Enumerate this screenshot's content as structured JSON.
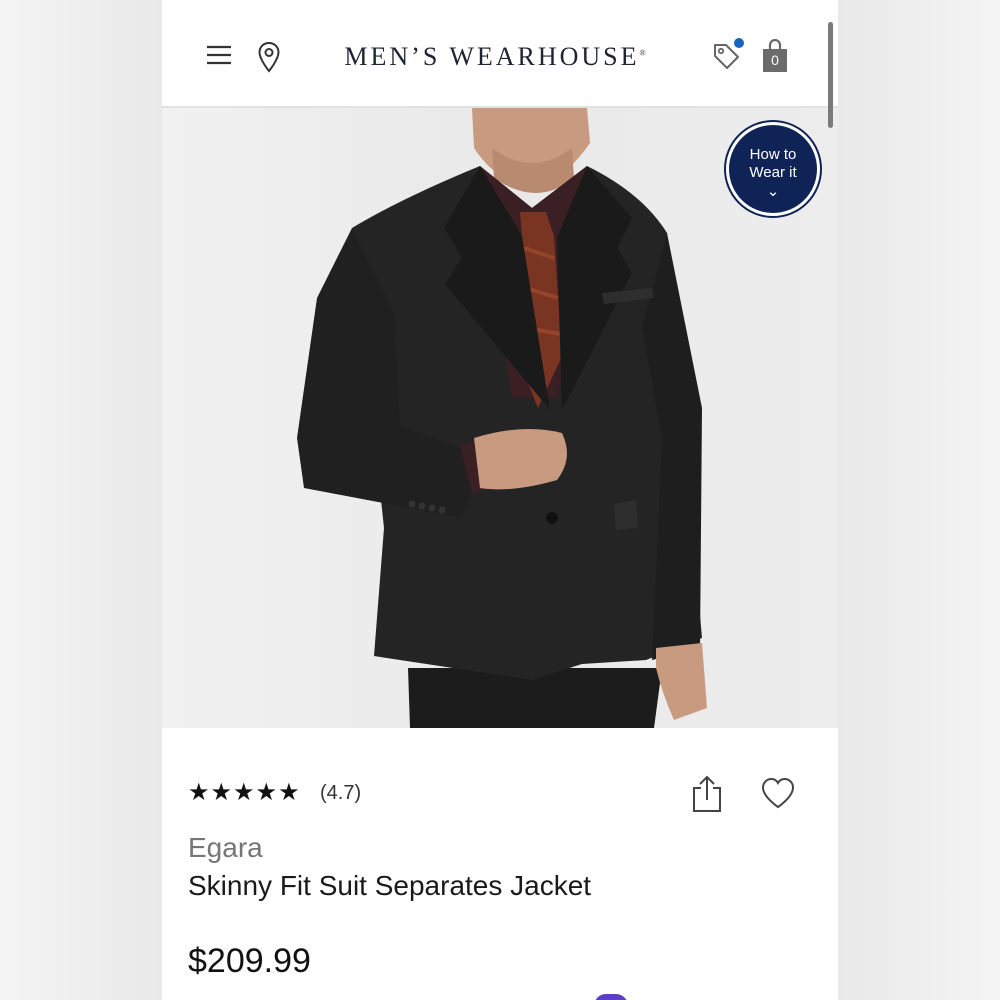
{
  "header": {
    "brand": "MEN’S WEARHOUSE",
    "brand_mark": "®",
    "cart_count": "0",
    "icons": [
      "menu-icon",
      "location-pin-icon",
      "tag-icon",
      "shopping-bag-icon"
    ],
    "notification_color": "#1565c0"
  },
  "hero": {
    "badge_line1": "How to",
    "badge_line2": "Wear it",
    "badge_chevron": "⌄",
    "badge_color": "#0f2357"
  },
  "product": {
    "stars": "★★★★★",
    "rating_value": 4.7,
    "rating_text": "(4.7)",
    "brand": "Egara",
    "name": "Skinny Fit Suit Separates Jacket",
    "price": "$209.99"
  }
}
